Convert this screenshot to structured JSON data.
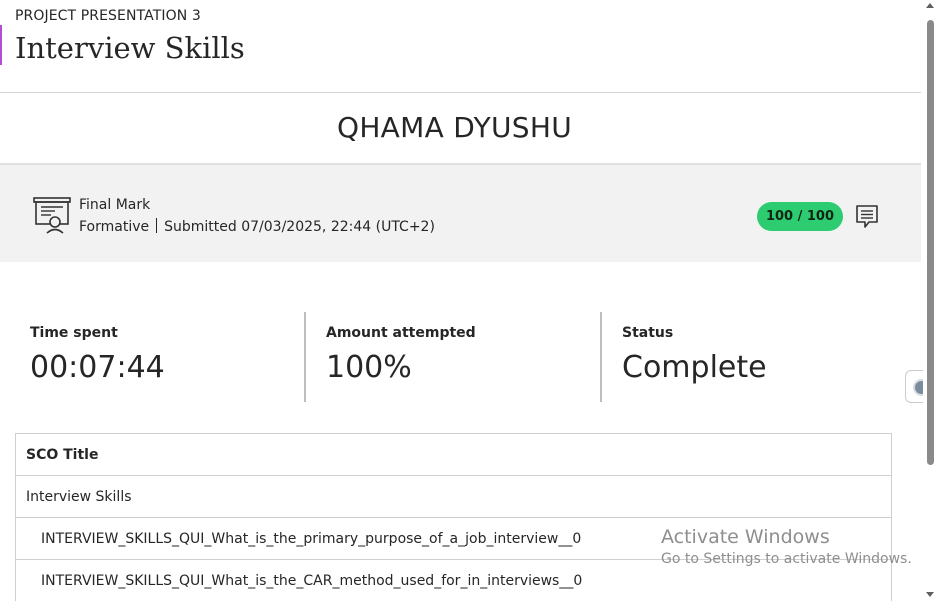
{
  "header": {
    "subtitle": "PROJECT PRESENTATION 3",
    "title": "Interview Skills"
  },
  "student": {
    "name": "QHAMA DYUSHU"
  },
  "mark": {
    "title": "Final Mark",
    "type": "Formative",
    "submitted": "Submitted 07/03/2025, 22:44 (UTC+2)",
    "score": "100 / 100",
    "score_color": "#2ecc71",
    "icon": "certificate-icon",
    "feedback_icon": "feedback-comment-icon"
  },
  "stats": [
    {
      "label": "Time spent",
      "value": "00:07:44"
    },
    {
      "label": "Amount attempted",
      "value": "100%"
    },
    {
      "label": "Status",
      "value": "Complete"
    }
  ],
  "table": {
    "header": "SCO Title",
    "rows": [
      "Interview Skills",
      "INTERVIEW_SKILLS_QUI_What_is_the_primary_purpose_of_a_job_interview__0",
      "INTERVIEW_SKILLS_QUI_What_is_the_CAR_method_used_for_in_interviews__0"
    ]
  },
  "watermark": {
    "line1": "Activate Windows",
    "line2": "Go to Settings to activate Windows."
  },
  "accent_color": "#b04fd1"
}
